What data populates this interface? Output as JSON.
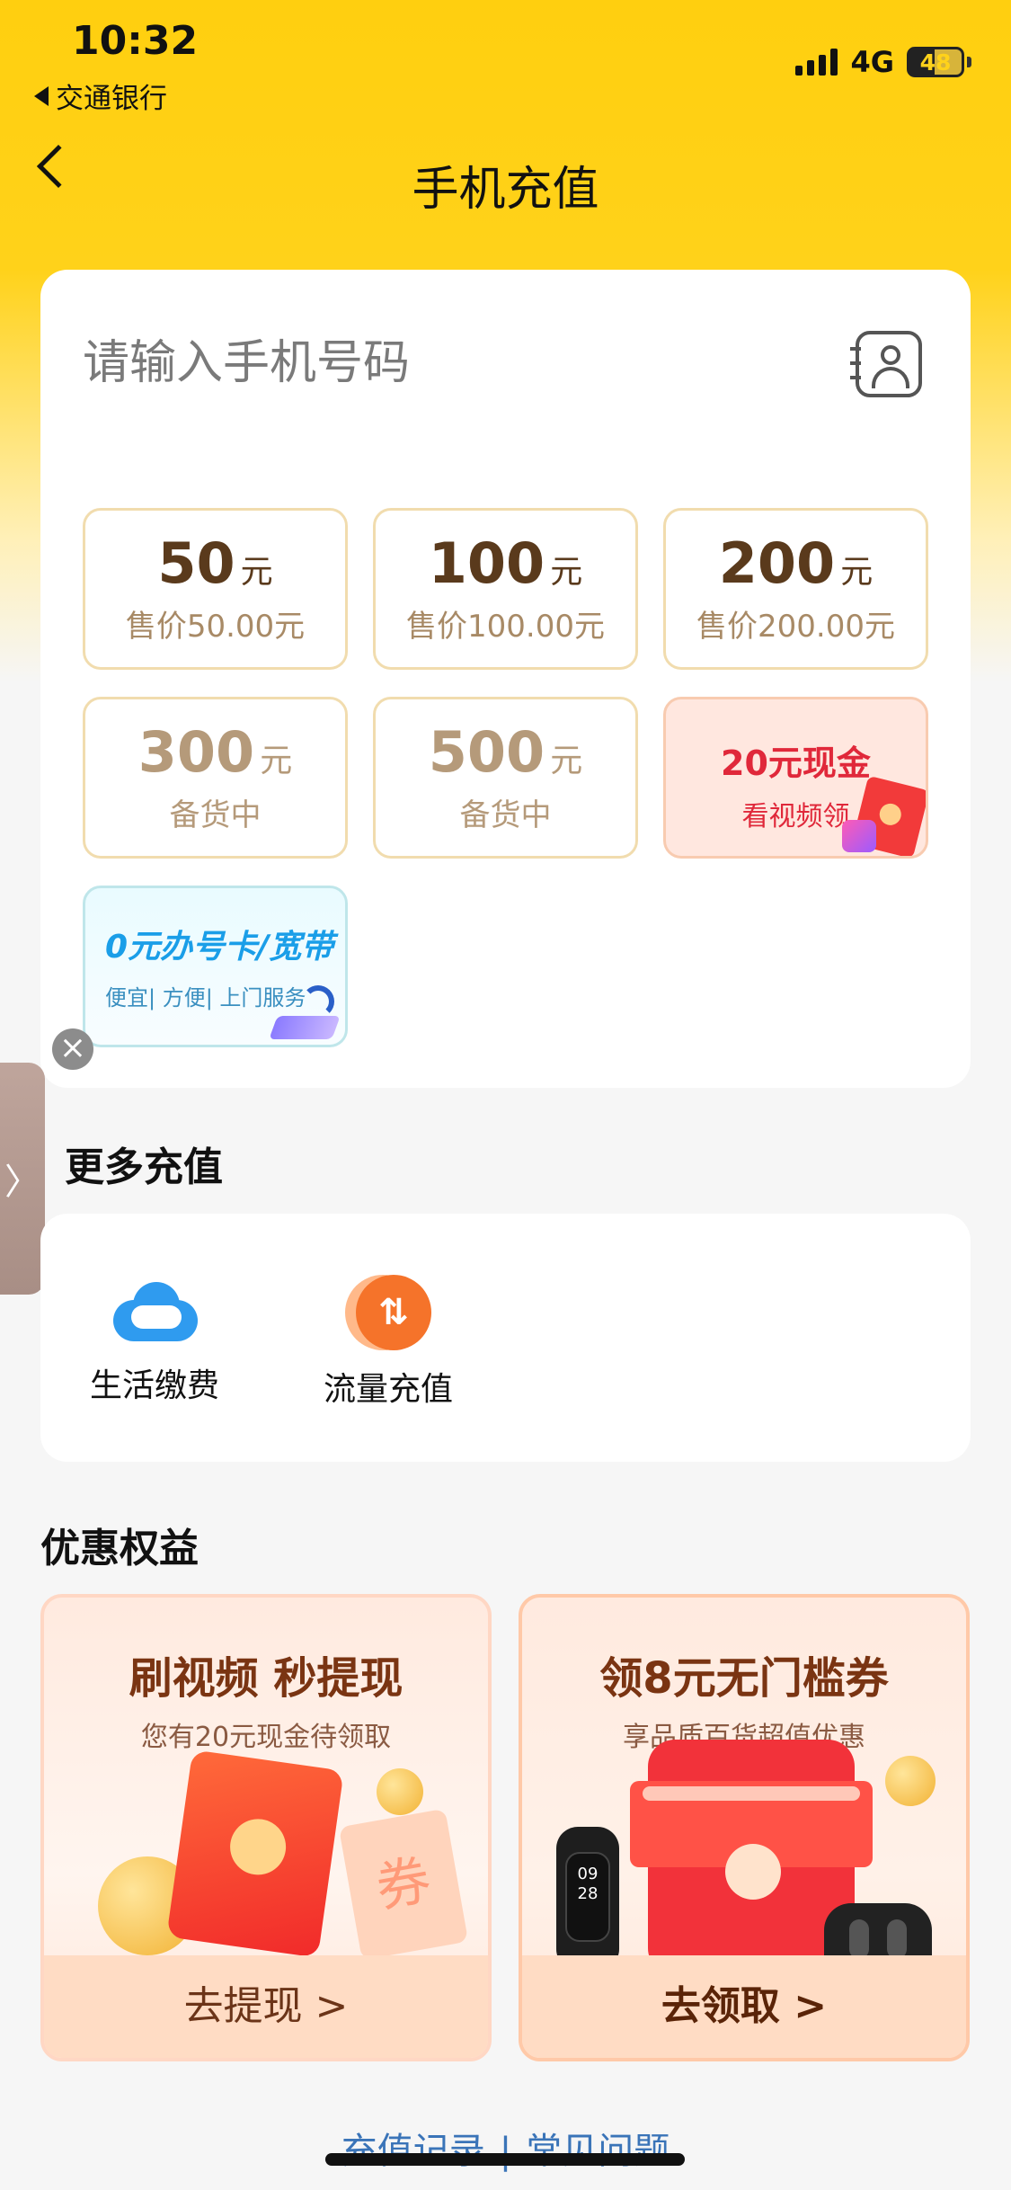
{
  "status_bar": {
    "time": "10:32",
    "back_app": "交通银行",
    "network": "4G",
    "battery": "48",
    "battery_level_percent": 48
  },
  "nav": {
    "title": "手机充值"
  },
  "phone": {
    "placeholder": "请输入手机号码"
  },
  "amounts": [
    {
      "value": "50",
      "unit": "元",
      "sub": "售价50.00元"
    },
    {
      "value": "100",
      "unit": "元",
      "sub": "售价100.00元"
    },
    {
      "value": "200",
      "unit": "元",
      "sub": "售价200.00元"
    },
    {
      "value": "300",
      "unit": "元",
      "sub": "备货中"
    },
    {
      "value": "500",
      "unit": "元",
      "sub": "备货中"
    }
  ],
  "promo_cash": {
    "title": "20元现金",
    "sub": "看视频领"
  },
  "promo_broadband": {
    "title": "0元办号卡/宽带",
    "sub": "便宜| 方便| 上门服务"
  },
  "more": {
    "title": "更多充值",
    "items": [
      {
        "label": "生活缴费",
        "icon": "cloud-icon"
      },
      {
        "label": "流量充值",
        "icon": "flow-swap-icon"
      }
    ]
  },
  "benefits": {
    "title": "优惠权益",
    "cards": [
      {
        "title": "刷视频 秒提现",
        "sub": "您有20元现金待领取",
        "button": "去提现 >",
        "coupon_char": "券"
      },
      {
        "title": "领8元无门槛券",
        "sub": "享品质百货超值优惠",
        "button": "去领取 >",
        "band_time": "09 28"
      }
    ]
  },
  "footer": {
    "records": "充值记录",
    "separator": "|",
    "faq": "常见问题"
  },
  "colors": {
    "brand_yellow": "#ffd21a",
    "brown_text": "#5a3a1c",
    "link_blue": "#3a74b8",
    "promo_red": "#e0283a"
  }
}
